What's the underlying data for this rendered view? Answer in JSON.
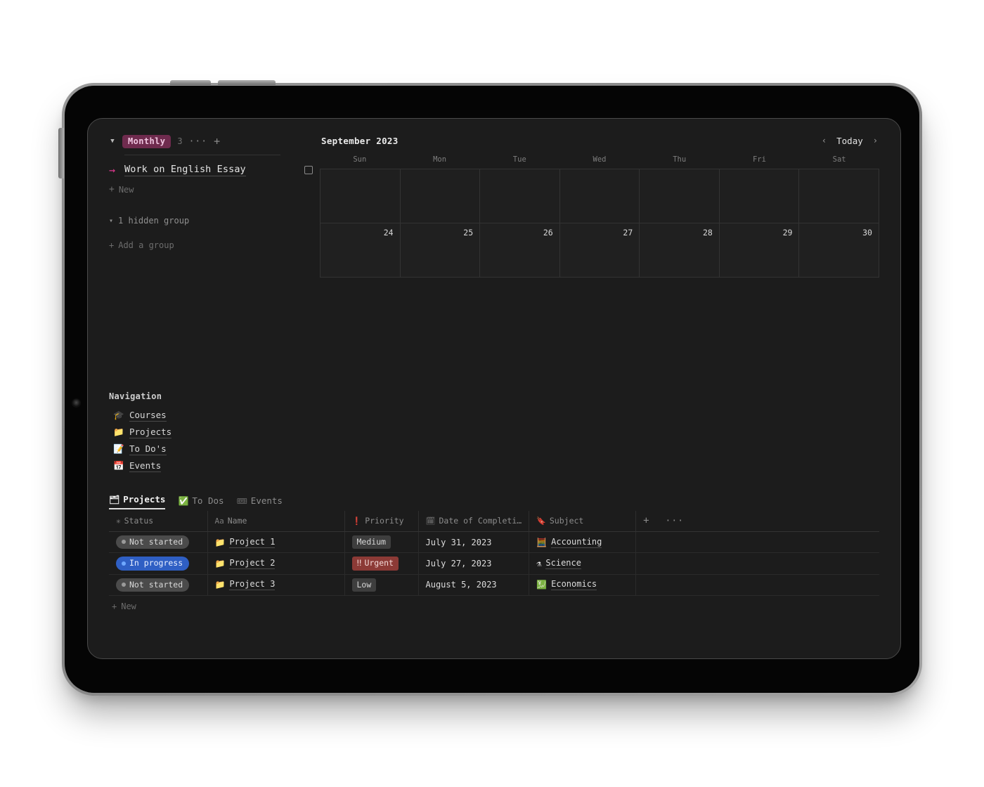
{
  "tasks_panel": {
    "group": {
      "collapse_icon": "chevron-down",
      "badge_label": "Monthly",
      "badge_color": "#6f2b4e",
      "count": "3",
      "more_icon": "···",
      "add_icon": "+"
    },
    "task": {
      "arrow_icon": "→",
      "title": "Work on English Essay",
      "checkbox_checked": false
    },
    "new_label": "New",
    "hidden_group_label": "1 hidden group",
    "add_group_label": "Add a group"
  },
  "calendar": {
    "month_title": "September 2023",
    "prev_icon": "‹",
    "today_label": "Today",
    "next_icon": "›",
    "day_names": [
      "Sun",
      "Mon",
      "Tue",
      "Wed",
      "Thu",
      "Fri",
      "Sat"
    ],
    "weeks": [
      [
        "",
        "",
        "",
        "",
        "",
        "",
        ""
      ],
      [
        "24",
        "25",
        "26",
        "27",
        "28",
        "29",
        "30"
      ]
    ]
  },
  "navigation": {
    "title": "Navigation",
    "items": [
      {
        "emoji": "🎓",
        "label": "Courses"
      },
      {
        "emoji": "📁",
        "label": "Projects"
      },
      {
        "emoji": "📝",
        "label": "To Do's"
      },
      {
        "emoji": "📅",
        "label": "Events"
      }
    ]
  },
  "database": {
    "tabs": [
      {
        "icon": "🗂",
        "label": "Projects",
        "active": true
      },
      {
        "icon": "✅",
        "label": "To Dos",
        "active": false
      },
      {
        "icon": "🎟",
        "label": "Events",
        "active": false
      }
    ],
    "columns": [
      {
        "icon": "✳",
        "label": "Status"
      },
      {
        "icon": "Aa",
        "label": "Name"
      },
      {
        "icon": "❗",
        "label": "Priority"
      },
      {
        "icon": "🗓",
        "label": "Date of Completi…"
      },
      {
        "icon": "🔖",
        "label": "Subject"
      }
    ],
    "add_column_icon": "+",
    "column_more_icon": "···",
    "rows": [
      {
        "status": "Not started",
        "status_style": "gray",
        "name": "Project 1",
        "name_emoji": "📁",
        "priority": "Medium",
        "priority_style": "gray",
        "priority_prefix": "",
        "date": "July 31, 2023",
        "subject": "Accounting",
        "subject_emoji": "🧮"
      },
      {
        "status": "In progress",
        "status_style": "blue",
        "name": "Project 2",
        "name_emoji": "📁",
        "priority": "Urgent",
        "priority_style": "red",
        "priority_prefix": "‼",
        "date": "July 27, 2023",
        "subject": "Science",
        "subject_emoji": "⚗"
      },
      {
        "status": "Not started",
        "status_style": "gray",
        "name": "Project 3",
        "name_emoji": "📁",
        "priority": "Low",
        "priority_style": "gray",
        "priority_prefix": "",
        "date": "August 5, 2023",
        "subject": "Economics",
        "subject_emoji": "💹"
      }
    ],
    "new_row_label": "New"
  }
}
